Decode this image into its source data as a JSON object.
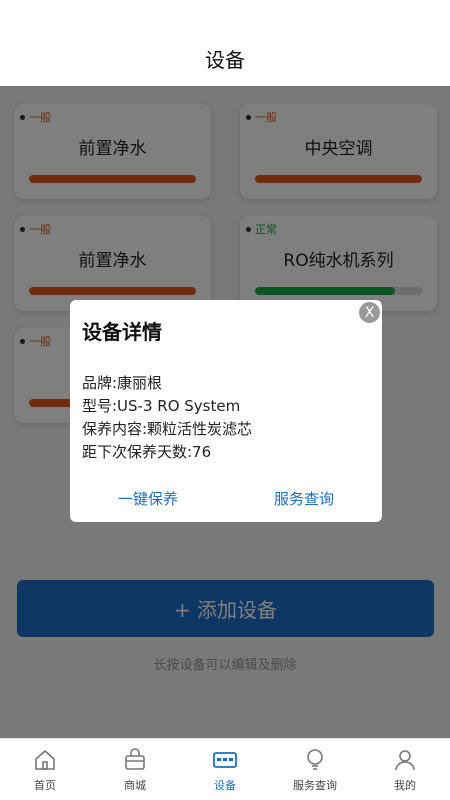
{
  "header": {
    "title": "设备"
  },
  "devices": [
    {
      "status": "一般",
      "status_color": "#e05a1a",
      "name": "前置净水",
      "progress": 1.0,
      "bar_color": "#e05a1a"
    },
    {
      "status": "一般",
      "status_color": "#e05a1a",
      "name": "中央空调",
      "progress": 1.0,
      "bar_color": "#e05a1a"
    },
    {
      "status": "一般",
      "status_color": "#e05a1a",
      "name": "前置净水",
      "progress": 1.0,
      "bar_color": "#e05a1a"
    },
    {
      "status": "正常",
      "status_color": "#1aa84a",
      "name": "RO纯水机系列",
      "progress": 0.84,
      "bar_color": "#1aa84a"
    },
    {
      "status": "一般",
      "status_color": "#e05a1a",
      "name": "",
      "progress": 1.0,
      "bar_color": "#e05a1a"
    }
  ],
  "add_button": {
    "label": "+ 添加设备"
  },
  "hint": "长按设备可以编辑及删除",
  "modal": {
    "title": "设备详情",
    "close": "X",
    "lines": [
      "品牌:康丽根",
      "型号:US-3 RO System",
      "保养内容:颗粒活性炭滤芯",
      "距下次保养天数:76"
    ],
    "actions": [
      "一键保养",
      "服务查询"
    ]
  },
  "tabs": [
    {
      "label": "首页",
      "icon": "home-icon"
    },
    {
      "label": "商城",
      "icon": "shop-icon"
    },
    {
      "label": "设备",
      "icon": "device-icon",
      "active": true
    },
    {
      "label": "服务查询",
      "icon": "service-icon"
    },
    {
      "label": "我的",
      "icon": "user-icon"
    }
  ]
}
